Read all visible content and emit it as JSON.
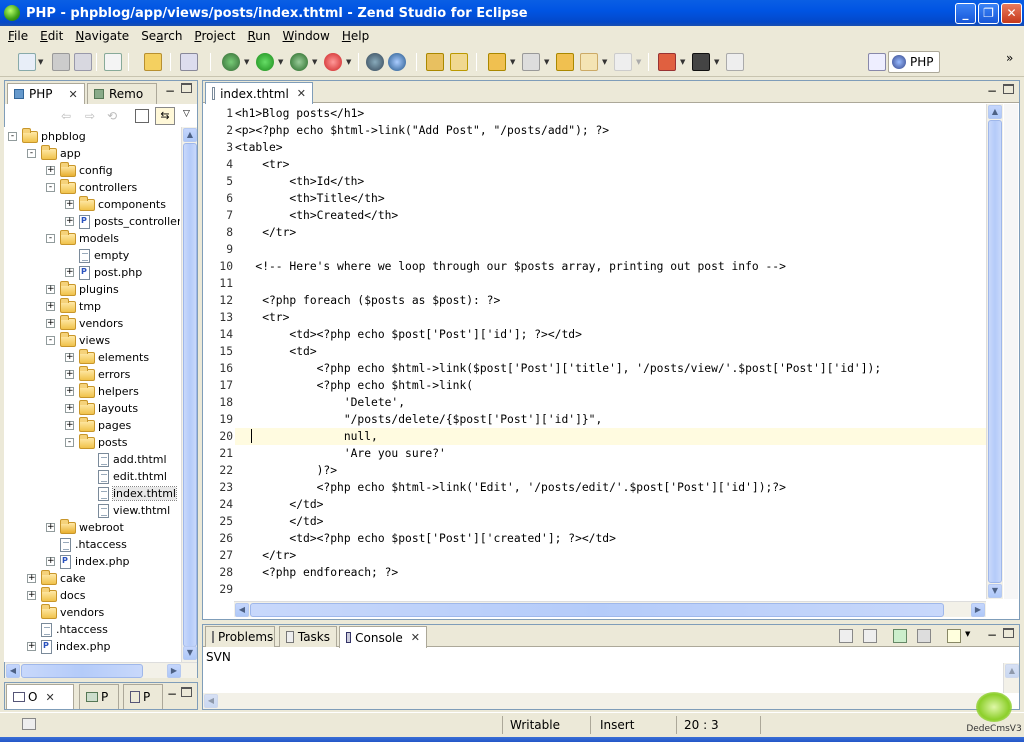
{
  "window": {
    "title": "PHP - phpblog/app/views/posts/index.thtml - Zend Studio for Eclipse"
  },
  "menu": [
    {
      "label": "File",
      "key": "F"
    },
    {
      "label": "Edit",
      "key": "E"
    },
    {
      "label": "Navigate",
      "key": "N"
    },
    {
      "label": "Search",
      "key": "a"
    },
    {
      "label": "Project",
      "key": "P"
    },
    {
      "label": "Run",
      "key": "R"
    },
    {
      "label": "Window",
      "key": "W"
    },
    {
      "label": "Help",
      "key": "H"
    }
  ],
  "perspective": {
    "label": "PHP"
  },
  "left_panel": {
    "tabs": [
      {
        "label": "PHP"
      },
      {
        "label": "Remo"
      }
    ],
    "tree": [
      {
        "label": "phpblog",
        "depth": 0,
        "exp": "-",
        "icon": "project"
      },
      {
        "label": "app",
        "depth": 1,
        "exp": "-",
        "icon": "folder"
      },
      {
        "label": "config",
        "depth": 2,
        "exp": "+",
        "icon": "pkg"
      },
      {
        "label": "controllers",
        "depth": 2,
        "exp": "-",
        "icon": "folder"
      },
      {
        "label": "components",
        "depth": 3,
        "exp": "+",
        "icon": "folder"
      },
      {
        "label": "posts_controller",
        "depth": 3,
        "exp": "+",
        "icon": "php"
      },
      {
        "label": "models",
        "depth": 2,
        "exp": "-",
        "icon": "folder"
      },
      {
        "label": "empty",
        "depth": 3,
        "exp": "",
        "icon": "txt"
      },
      {
        "label": "post.php",
        "depth": 3,
        "exp": "+",
        "icon": "php"
      },
      {
        "label": "plugins",
        "depth": 2,
        "exp": "+",
        "icon": "folder"
      },
      {
        "label": "tmp",
        "depth": 2,
        "exp": "+",
        "icon": "folder"
      },
      {
        "label": "vendors",
        "depth": 2,
        "exp": "+",
        "icon": "folder"
      },
      {
        "label": "views",
        "depth": 2,
        "exp": "-",
        "icon": "folder"
      },
      {
        "label": "elements",
        "depth": 3,
        "exp": "+",
        "icon": "folder"
      },
      {
        "label": "errors",
        "depth": 3,
        "exp": "+",
        "icon": "folder"
      },
      {
        "label": "helpers",
        "depth": 3,
        "exp": "+",
        "icon": "folder"
      },
      {
        "label": "layouts",
        "depth": 3,
        "exp": "+",
        "icon": "folder"
      },
      {
        "label": "pages",
        "depth": 3,
        "exp": "+",
        "icon": "folder"
      },
      {
        "label": "posts",
        "depth": 3,
        "exp": "-",
        "icon": "folder"
      },
      {
        "label": "add.thtml",
        "depth": 4,
        "exp": "",
        "icon": "txt"
      },
      {
        "label": "edit.thtml",
        "depth": 4,
        "exp": "",
        "icon": "txt"
      },
      {
        "label": "index.thtml",
        "depth": 4,
        "exp": "",
        "icon": "txt",
        "selected": true
      },
      {
        "label": "view.thtml",
        "depth": 4,
        "exp": "",
        "icon": "txt"
      },
      {
        "label": "webroot",
        "depth": 2,
        "exp": "+",
        "icon": "pkg"
      },
      {
        "label": ".htaccess",
        "depth": 2,
        "exp": "",
        "icon": "txt"
      },
      {
        "label": "index.php",
        "depth": 2,
        "exp": "+",
        "icon": "php"
      },
      {
        "label": "cake",
        "depth": 1,
        "exp": "+",
        "icon": "folder"
      },
      {
        "label": "docs",
        "depth": 1,
        "exp": "+",
        "icon": "folder"
      },
      {
        "label": "vendors",
        "depth": 1,
        "exp": "",
        "icon": "folder"
      },
      {
        "label": ".htaccess",
        "depth": 1,
        "exp": "",
        "icon": "txt"
      },
      {
        "label": "index.php",
        "depth": 1,
        "exp": "+",
        "icon": "php"
      }
    ]
  },
  "outline_panel": {
    "tabs": [
      {
        "label": "O"
      },
      {
        "label": "P"
      },
      {
        "label": "P"
      }
    ]
  },
  "editor": {
    "tab": "index.thtml",
    "current_line": 20,
    "lines": [
      "<h1>Blog posts</h1>",
      "<p><?php echo $html->link(\"Add Post\", \"/posts/add\"); ?>",
      "<table>",
      "    <tr>",
      "        <th>Id</th>",
      "        <th>Title</th>",
      "        <th>Created</th>",
      "    </tr>",
      "",
      "   <!-- Here's where we loop through our $posts array, printing out post info -->",
      "",
      "    <?php foreach ($posts as $post): ?>",
      "    <tr>",
      "        <td><?php echo $post['Post']['id']; ?></td>",
      "        <td>",
      "            <?php echo $html->link($post['Post']['title'], '/posts/view/'.$post['Post']['id']);",
      "            <?php echo $html->link(",
      "                'Delete',",
      "                \"/posts/delete/{$post['Post']['id']}\",",
      "                null,",
      "                'Are you sure?'",
      "            )?>",
      "            <?php echo $html->link('Edit', '/posts/edit/'.$post['Post']['id']);?>",
      "        </td>",
      "        </td>",
      "        <td><?php echo $post['Post']['created']; ?></td>",
      "    </tr>",
      "    <?php endforeach; ?>",
      ""
    ]
  },
  "bottom_panel": {
    "tabs": [
      {
        "label": "Problems"
      },
      {
        "label": "Tasks"
      },
      {
        "label": "Console"
      }
    ],
    "content": "SVN"
  },
  "status": {
    "writable": "Writable",
    "insert": "Insert",
    "position": "20 : 3"
  },
  "watermark": {
    "text": "DedeCmsV3"
  }
}
